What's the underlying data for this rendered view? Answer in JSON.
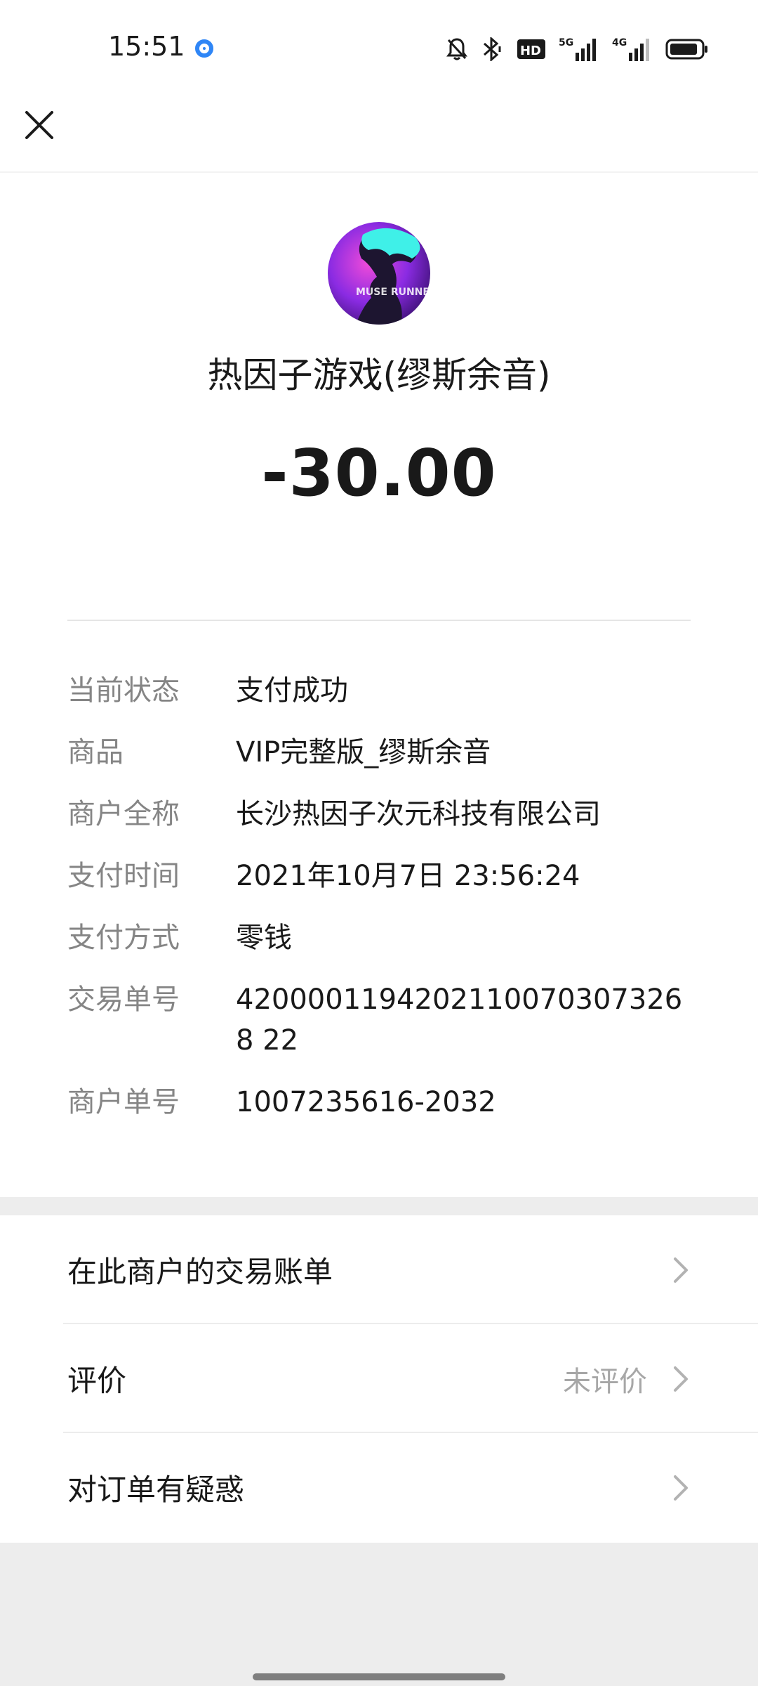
{
  "status_bar": {
    "time": "15:51",
    "icons": [
      "mute-bell-icon",
      "bluetooth-icon",
      "hd-icon",
      "5g-signal-icon",
      "4g-signal-icon",
      "battery-icon"
    ],
    "hd_label": "HD",
    "net1": "5G",
    "net2": "4G"
  },
  "header": {
    "close_icon": "close-icon"
  },
  "merchant": {
    "avatar_text": "MUSE RUNNER",
    "name": "热因子游戏(缪斯余音)",
    "amount": "-30.00"
  },
  "details": [
    {
      "label": "当前状态",
      "value": "支付成功"
    },
    {
      "label": "商品",
      "value": "VIP完整版_缪斯余音"
    },
    {
      "label": "商户全称",
      "value": "长沙热因子次元科技有限公司"
    },
    {
      "label": "支付时间",
      "value": "2021年10月7日 23:56:24"
    },
    {
      "label": "支付方式",
      "value": "零钱"
    },
    {
      "label": "交易单号",
      "value": "42000011942021100703073268 22"
    },
    {
      "label": "商户单号",
      "value": "1007235616-2032"
    }
  ],
  "actions": [
    {
      "label": "在此商户的交易账单",
      "status": ""
    },
    {
      "label": "评价",
      "status": "未评价"
    },
    {
      "label": "对订单有疑惑",
      "status": ""
    }
  ],
  "colors": {
    "accent_blue": "#2f86f6",
    "text": "#191919",
    "label_gray": "#858585",
    "bg_gray": "#ededed"
  }
}
